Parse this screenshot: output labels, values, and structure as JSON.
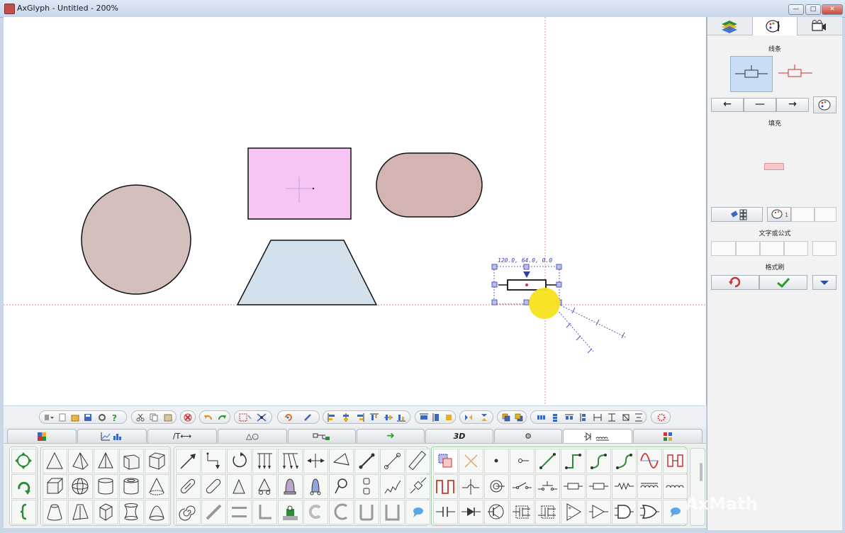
{
  "window": {
    "title": "AxGlyph - Untitled - 200%",
    "minimize_glyph": "—",
    "maximize_glyph": "□",
    "close_glyph": "✕"
  },
  "canvas": {
    "coord_readout": "120.0, 64.0, 0.0",
    "colors": {
      "circle_fill": "#d3c0bd",
      "rect_fill": "#f7c4f4",
      "capsule_fill": "#d4b4b1",
      "trapezoid_fill": "#d3e1ec",
      "guide": "#e06b6b",
      "selection": "#3a3ab0",
      "cursor": "#f7e31c"
    }
  },
  "right_panel": {
    "tabs": [
      "layers-icon",
      "style-icon",
      "camera-icon"
    ],
    "line_label": "线条",
    "fill_label": "填充",
    "text_formula_label": "文字或公式",
    "format_brush_label": "格式刷",
    "arrow_left": "←",
    "arrow_none": "—",
    "arrow_right": "→",
    "palette_badge": "1"
  },
  "palette_tabs": [
    {
      "name": "color",
      "label": ""
    },
    {
      "name": "chart",
      "label": ""
    },
    {
      "name": "text-line",
      "label": "/T⟷"
    },
    {
      "name": "shapes",
      "label": "△○"
    },
    {
      "name": "connector",
      "label": ""
    },
    {
      "name": "arrow",
      "label": "➜"
    },
    {
      "name": "3d",
      "label": "3D"
    },
    {
      "name": "gear",
      "label": "⚙"
    },
    {
      "name": "circuit",
      "label": ""
    },
    {
      "name": "misc",
      "label": ""
    }
  ],
  "watermark": "AxMath"
}
